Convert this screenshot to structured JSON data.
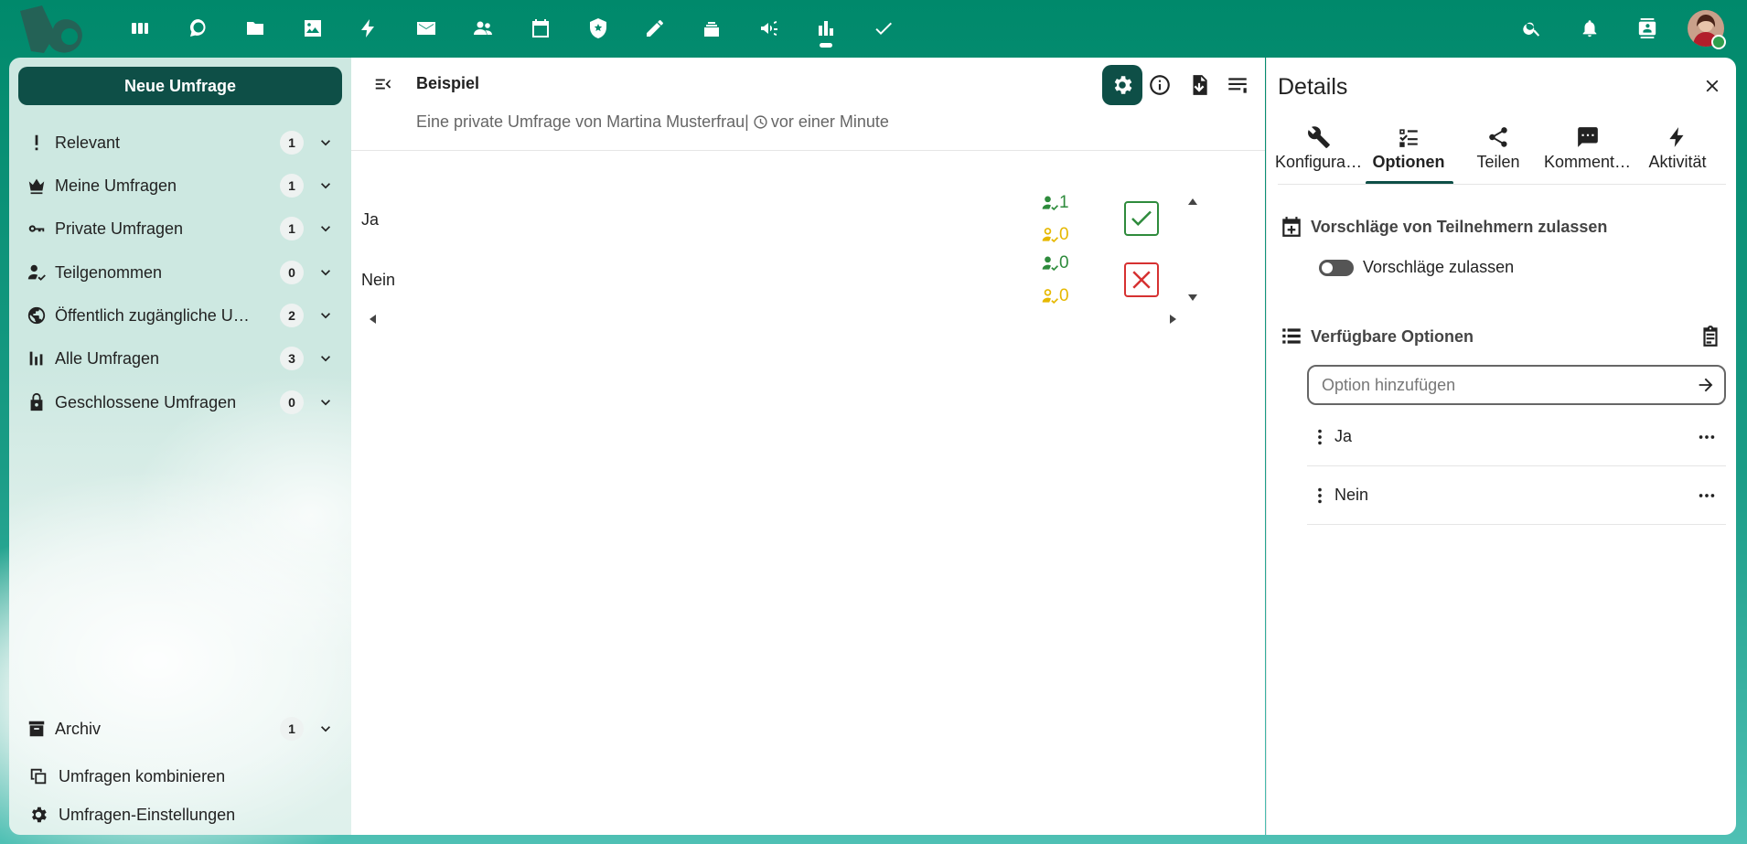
{
  "header": {
    "apps": [
      {
        "name": "dashboard-icon"
      },
      {
        "name": "talk-icon"
      },
      {
        "name": "files-icon"
      },
      {
        "name": "photos-icon"
      },
      {
        "name": "activity-icon"
      },
      {
        "name": "mail-icon"
      },
      {
        "name": "contacts-icon"
      },
      {
        "name": "calendar-icon"
      },
      {
        "name": "security-icon"
      },
      {
        "name": "notes-icon"
      },
      {
        "name": "deck-icon"
      },
      {
        "name": "announcements-icon"
      },
      {
        "name": "polls-icon"
      },
      {
        "name": "tasks-icon"
      }
    ],
    "right_icons": [
      "search-icon",
      "notifications-icon",
      "contacts-menu-icon"
    ]
  },
  "nav": {
    "new_poll": "Neue Umfrage",
    "items": [
      {
        "label": "Relevant",
        "count": "1",
        "icon": "exclamation-icon"
      },
      {
        "label": "Meine Umfragen",
        "count": "1",
        "icon": "crown-icon"
      },
      {
        "label": "Private Umfragen",
        "count": "1",
        "icon": "key-icon"
      },
      {
        "label": "Teilgenommen",
        "count": "0",
        "icon": "account-check-icon"
      },
      {
        "label": "Öffentlich zugängliche Umfragen",
        "count": "2",
        "icon": "globe-icon"
      },
      {
        "label": "Alle Umfragen",
        "count": "3",
        "icon": "bar-chart-icon"
      },
      {
        "label": "Geschlossene Umfragen",
        "count": "0",
        "icon": "lock-icon"
      }
    ],
    "archive": {
      "label": "Archiv",
      "count": "1",
      "icon": "archive-icon"
    },
    "combine": "Umfragen kombinieren",
    "settings": "Umfragen-Einstellungen"
  },
  "main": {
    "title": "Beispiel",
    "subtitle": "Eine private Umfrage von Martina Musterfrau",
    "separator": "|",
    "time": "vor einer Minute",
    "options": [
      {
        "label": "Ja",
        "yes": "1",
        "maybe": "0",
        "vote": "yes"
      },
      {
        "label": "Nein",
        "yes": "0",
        "maybe": "0",
        "vote": "no"
      }
    ]
  },
  "sidebar": {
    "title": "Details",
    "tabs": [
      {
        "label": "Konfiguration",
        "icon": "wrench-icon"
      },
      {
        "label": "Optionen",
        "icon": "checklist-icon",
        "active": true
      },
      {
        "label": "Teilen",
        "icon": "share-icon"
      },
      {
        "label": "Kommentare",
        "icon": "comment-icon"
      },
      {
        "label": "Aktivität",
        "icon": "lightning-icon"
      }
    ],
    "proposals_heading": "Vorschläge von Teilnehmern zulassen",
    "proposals_toggle": "Vorschläge zulassen",
    "options_heading": "Verfügbare Optionen",
    "input_placeholder": "Option hinzufügen",
    "options": [
      "Ja",
      "Nein"
    ]
  },
  "colors": {
    "brand": "#00896b",
    "primary_dark": "#0e4f47",
    "yes": "#2e8b3c",
    "maybe": "#e6b800",
    "no": "#d63131"
  }
}
